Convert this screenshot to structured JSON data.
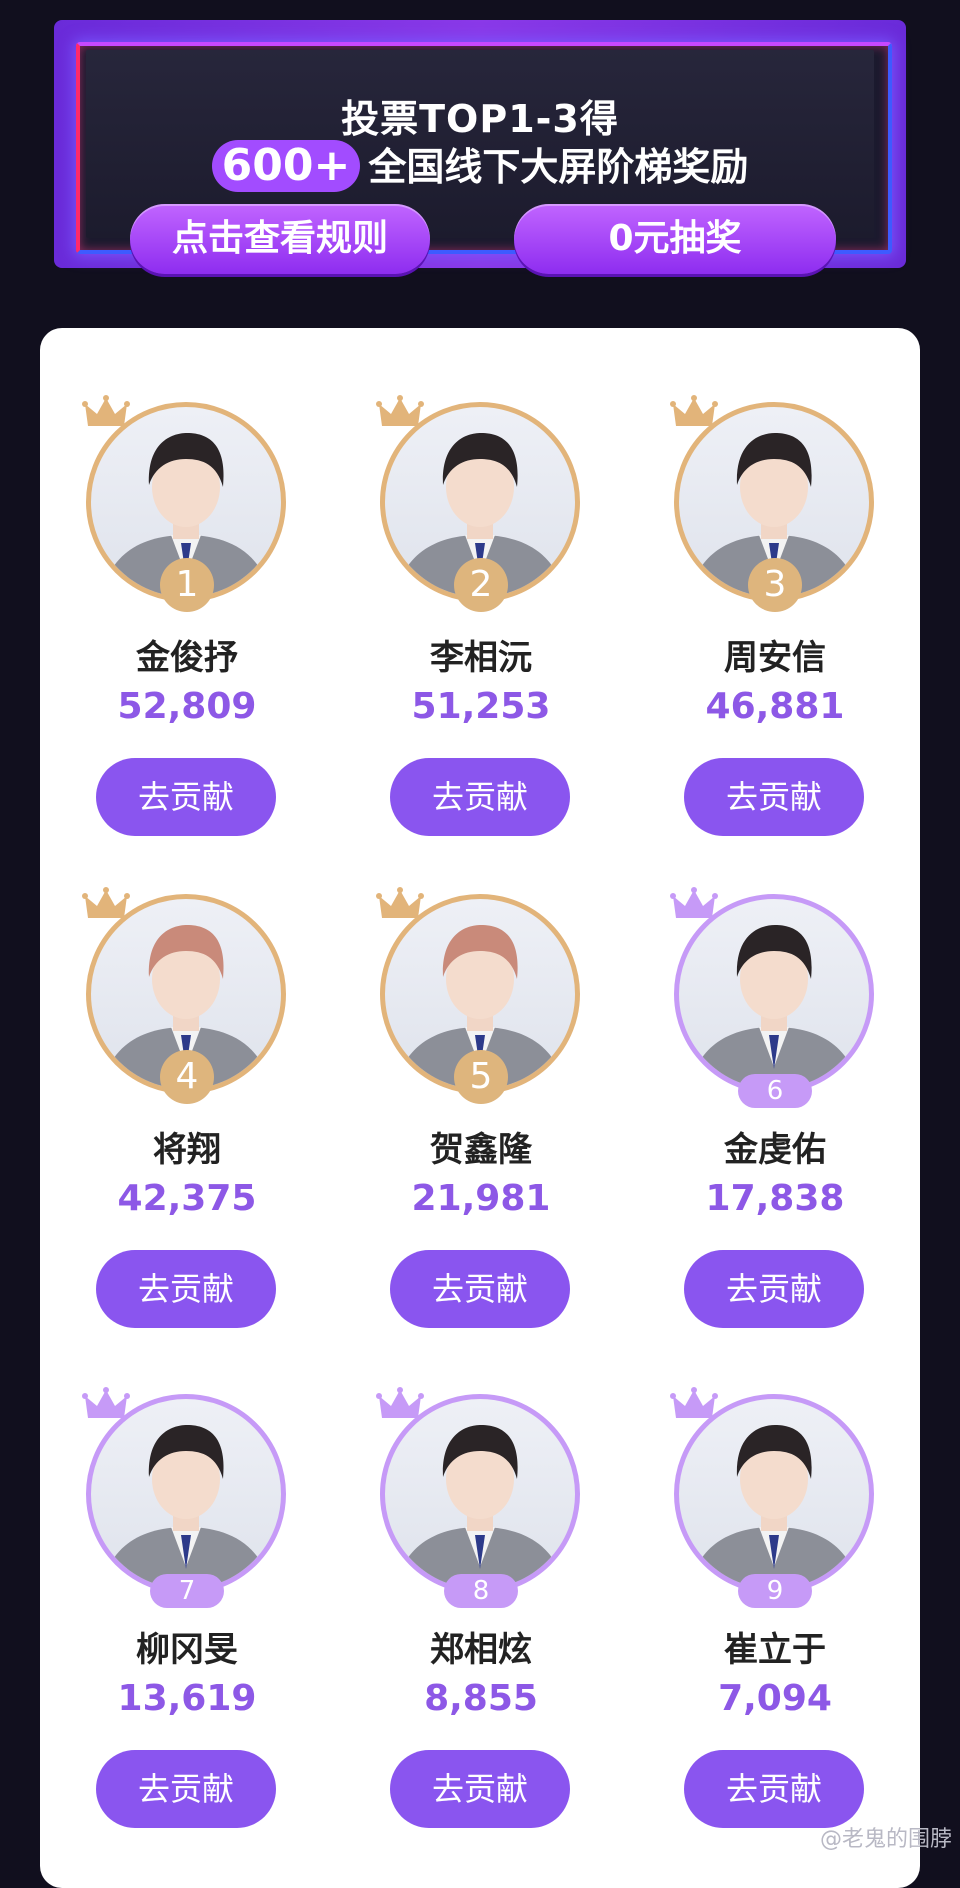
{
  "banner": {
    "line1": "投票TOP1-3得",
    "highlight": "600+",
    "line2": "全国线下大屏阶梯奖励",
    "rules_button": "点击查看规则",
    "lottery_button": "0元抽奖"
  },
  "contestants": [
    {
      "rank": "1",
      "name": "金俊抒",
      "votes": "52,809",
      "button": "去贡献"
    },
    {
      "rank": "2",
      "name": "李相沅",
      "votes": "51,253",
      "button": "去贡献"
    },
    {
      "rank": "3",
      "name": "周安信",
      "votes": "46,881",
      "button": "去贡献"
    },
    {
      "rank": "4",
      "name": "将翔",
      "votes": "42,375",
      "button": "去贡献"
    },
    {
      "rank": "5",
      "name": "贺鑫隆",
      "votes": "21,981",
      "button": "去贡献"
    },
    {
      "rank": "6",
      "name": "金虔佑",
      "votes": "17,838",
      "button": "去贡献"
    },
    {
      "rank": "7",
      "name": "柳冈旻",
      "votes": "13,619",
      "button": "去贡献"
    },
    {
      "rank": "8",
      "name": "郑相炫",
      "votes": "8,855",
      "button": "去贡献"
    },
    {
      "rank": "9",
      "name": "崔立于",
      "votes": "7,094",
      "button": "去贡献"
    }
  ],
  "watermark": "@老鬼的围脖",
  "colors": {
    "accent": "#8a55ef",
    "gold": "#deb57d",
    "lavender": "#c69af7"
  }
}
